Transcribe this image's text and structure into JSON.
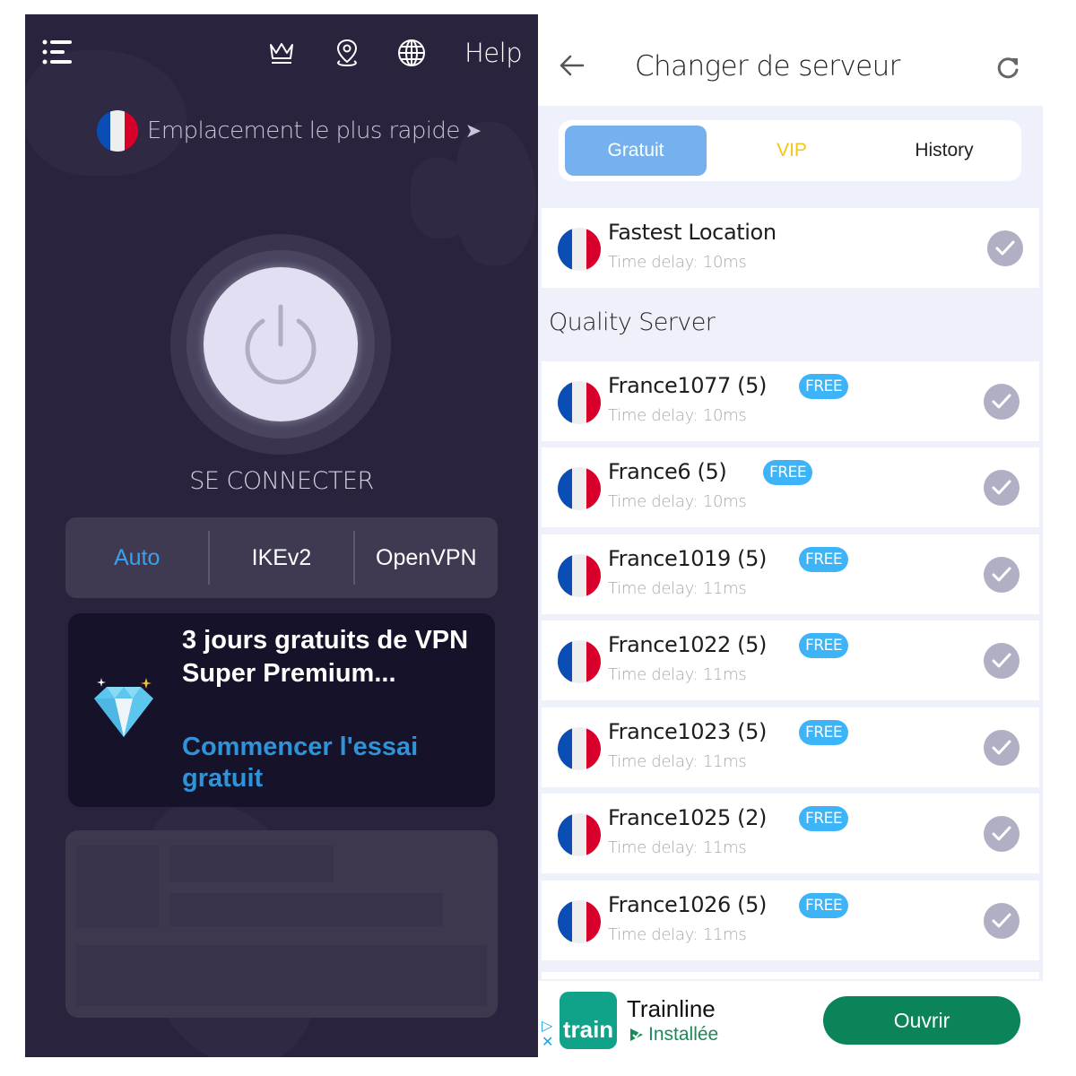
{
  "left_panel": {
    "topbar": {
      "menu_icon": "menu-list-icon",
      "crown_icon": "crown-icon",
      "location_icon": "map-pin-icon",
      "globe_icon": "globe-icon",
      "help_label": "Help"
    },
    "location": {
      "flag": "france-flag",
      "label": "Emplacement le plus rapide",
      "chevron": "›"
    },
    "power": {
      "icon": "power-icon",
      "label": "SE CONNECTER"
    },
    "protocols": {
      "selected": "Auto",
      "items": [
        {
          "label": "Auto",
          "active": true
        },
        {
          "label": "IKEv2",
          "active": false
        },
        {
          "label": "OpenVPN",
          "active": false
        }
      ]
    },
    "promo": {
      "icon": "diamond-icon",
      "title": "3 jours gratuits de VPN Super Premium...",
      "cta": "Commencer l'essai gratuit"
    }
  },
  "right_panel": {
    "header": {
      "back_icon": "arrow-left-icon",
      "title": "Changer de serveur",
      "refresh_icon": "refresh-icon"
    },
    "tabs": [
      {
        "label": "Gratuit",
        "active": true
      },
      {
        "label": "VIP",
        "active": false
      },
      {
        "label": "History",
        "active": false
      }
    ],
    "fastest": {
      "name": "Fastest Location",
      "delay": "Time delay: 10ms"
    },
    "section_title": "Quality Server",
    "servers": [
      {
        "name": "France1077 (5)",
        "badge": "FREE",
        "delay": "Time delay: 10ms"
      },
      {
        "name": "France6 (5)",
        "badge": "FREE",
        "delay": "Time delay: 10ms"
      },
      {
        "name": "France1019 (5)",
        "badge": "FREE",
        "delay": "Time delay: 11ms"
      },
      {
        "name": "France1022 (5)",
        "badge": "FREE",
        "delay": "Time delay: 11ms"
      },
      {
        "name": "France1023 (5)",
        "badge": "FREE",
        "delay": "Time delay: 11ms"
      },
      {
        "name": "France1025 (2)",
        "badge": "FREE",
        "delay": "Time delay: 11ms"
      },
      {
        "name": "France1026 (5)",
        "badge": "FREE",
        "delay": "Time delay: 11ms"
      }
    ],
    "ad": {
      "app_icon_text": "train",
      "app_name": "Trainline",
      "status": "Installée",
      "button": "Ouvrir"
    }
  },
  "colors": {
    "left_bg": "#29233d",
    "accent_blue": "#3aa1ec",
    "tab_active": "#75b1ee",
    "vip": "#f5c518",
    "free_badge": "#3db4f7",
    "ad_button": "#0a8458"
  }
}
